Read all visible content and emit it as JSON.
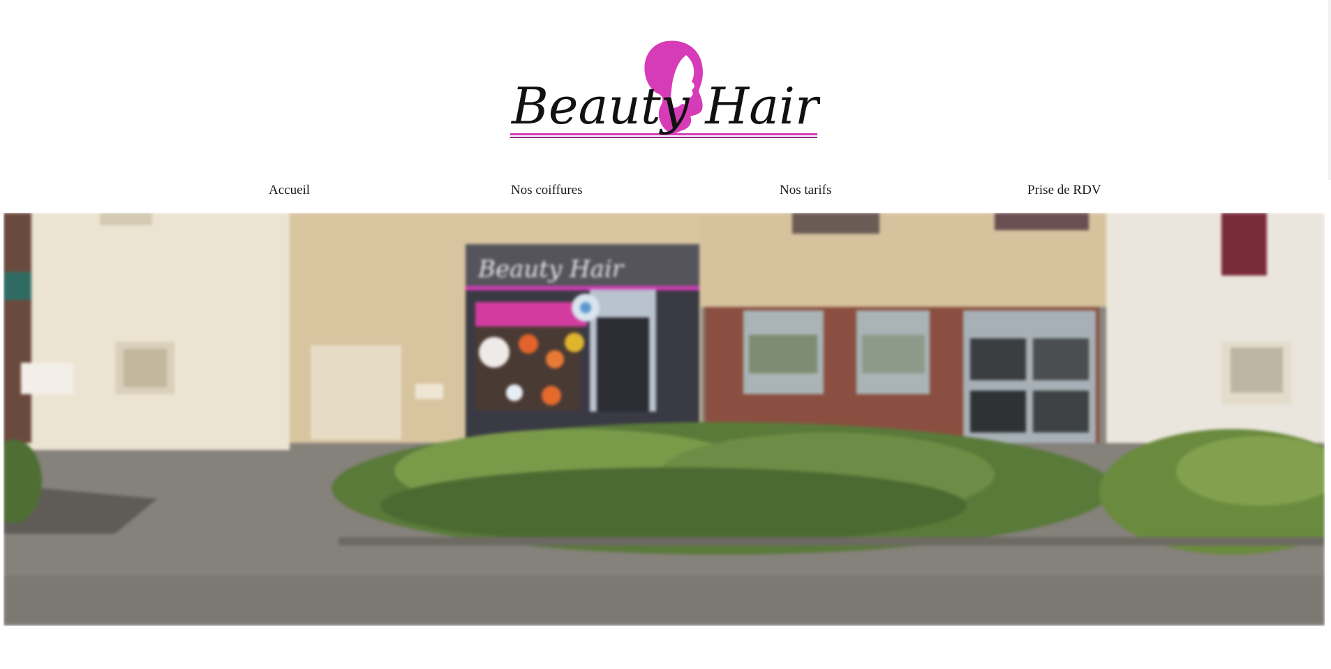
{
  "brand": {
    "logo_text": "Beauty Hair",
    "accent_color": "#d63bb8",
    "line_color": "#8a2b80"
  },
  "nav": {
    "items": [
      {
        "label": "Accueil"
      },
      {
        "label": "Nos coiffures"
      },
      {
        "label": "Nos tarifs"
      },
      {
        "label": "Prise de RDV"
      }
    ]
  },
  "hero": {
    "storefront_sign": "Beauty Hair"
  }
}
